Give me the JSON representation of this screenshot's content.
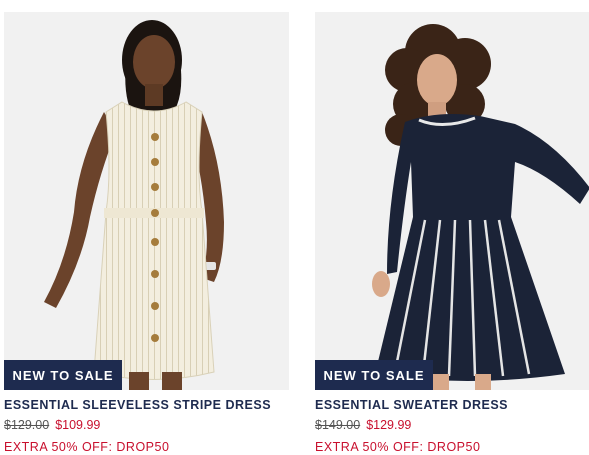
{
  "products": [
    {
      "badge": "NEW TO SALE",
      "name": "ESSENTIAL SLEEVELESS STRIPE DRESS",
      "original_price": "$129.00",
      "sale_price": "$109.99",
      "promo": "EXTRA 50% OFF: DROP50"
    },
    {
      "badge": "NEW TO SALE",
      "name": "ESSENTIAL SWEATER DRESS",
      "original_price": "$149.00",
      "sale_price": "$129.99",
      "promo": "EXTRA 50% OFF: DROP50"
    }
  ],
  "colors": {
    "badge_bg": "#1e2b4f",
    "title": "#1e2b4f",
    "sale_red": "#c8102e",
    "photo_bg": "#f1f1f1"
  }
}
